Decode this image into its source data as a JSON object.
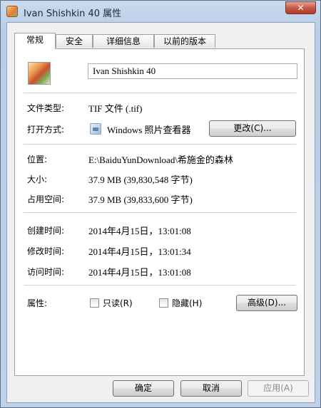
{
  "window": {
    "title": "Ivan Shishkin 40 属性",
    "close_label": "✕"
  },
  "tabs": [
    {
      "label": "常规",
      "active": true
    },
    {
      "label": "安全",
      "active": false
    },
    {
      "label": "详细信息",
      "active": false
    },
    {
      "label": "以前的版本",
      "active": false
    }
  ],
  "file": {
    "name": "Ivan Shishkin 40",
    "type_label": "文件类型:",
    "type_value": "TIF 文件 (.tif)",
    "opens_with_label": "打开方式:",
    "opens_with_value": "Windows 照片查看器",
    "change_button": "更改(C)...",
    "location_label": "位置:",
    "location_value": "E:\\BaiduYunDownload\\希施金的森林",
    "size_label": "大小:",
    "size_value": "37.9 MB (39,830,548 字节)",
    "size_on_disk_label": "占用空间:",
    "size_on_disk_value": "37.9 MB (39,833,600 字节)",
    "created_label": "创建时间:",
    "created_value": "2014年4月15日，13:01:08",
    "modified_label": "修改时间:",
    "modified_value": "2014年4月15日，13:01:34",
    "accessed_label": "访问时间:",
    "accessed_value": "2014年4月15日，13:01:08",
    "attributes_label": "属性:",
    "readonly_label": "只读(R)",
    "hidden_label": "隐藏(H)",
    "advanced_button": "高级(D)..."
  },
  "footer": {
    "ok": "确定",
    "cancel": "取消",
    "apply": "应用(A)"
  }
}
